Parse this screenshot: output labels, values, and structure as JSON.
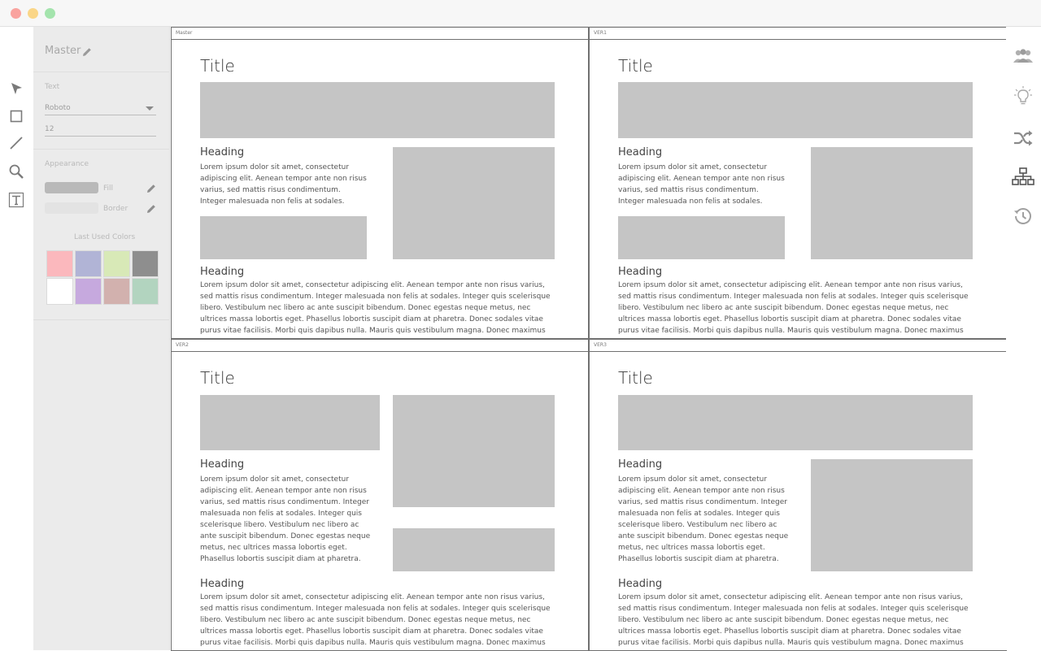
{
  "window": {
    "traffic_lights": [
      "#ff6159",
      "#ffbd2e",
      "#28c941"
    ]
  },
  "left_tools": [
    "pointer-icon",
    "rectangle-icon",
    "line-icon",
    "zoom-icon",
    "text-tool-icon"
  ],
  "properties": {
    "master_name": "Master",
    "text_section_label": "Text",
    "font_family_value": "Roboto",
    "font_size_value": "12",
    "appearance_label": "Appearance",
    "fill_label": "Fill",
    "border_label": "Border",
    "last_used_colors_label": "Last Used Colors",
    "last_used_colors": [
      "#fbb8bd",
      "#b1b4d6",
      "#d8e9b7",
      "#8e8e8e",
      "#ffffff",
      "#c6a9de",
      "#d2b1ae",
      "#b2d4bf"
    ]
  },
  "right_tools": [
    "people-icon",
    "lightbulb-icon",
    "shuffle-icon",
    "sitemap-icon",
    "history-icon"
  ],
  "frames": [
    {
      "label": "Master",
      "title": "Title",
      "heading1": "Heading",
      "para1": "Lorem ipsum dolor sit amet, consectetur adipiscing elit. Aenean tempor ante non risus varius, sed mattis risus condimentum. Integer malesuada non felis at sodales. Integer quis",
      "heading2": "Heading",
      "para2": "Lorem ipsum dolor sit amet, consectetur adipiscing elit. Aenean tempor ante non risus varius, sed mattis risus condimentum. Integer malesuada non felis at sodales. Integer quis scelerisque libero. Vestibulum nec libero ac ante suscipit bibendum. Donec egestas neque metus, nec ultrices massa lobortis eget. Phasellus lobortis suscipit diam at pharetra. Donec sodales vitae purus vitae facilisis. Morbi quis dapibus nulla. Mauris quis vestibulum magna. Donec maximus neque vel libero tincidunt elementum."
    },
    {
      "label": "VER1",
      "title": "Title",
      "heading1": "Heading",
      "para1": "Lorem ipsum dolor sit amet, consectetur adipiscing elit. Aenean tempor ante non risus varius, sed mattis risus condimentum. Integer malesuada non felis at sodales. Integer quis",
      "heading2": "Heading",
      "para2": "Lorem ipsum dolor sit amet, consectetur adipiscing elit. Aenean tempor ante non risus varius, sed mattis risus condimentum. Integer malesuada non felis at sodales. Integer quis scelerisque libero. Vestibulum nec libero ac ante suscipit bibendum. Donec egestas neque metus, nec ultrices massa lobortis eget. Phasellus lobortis suscipit diam at pharetra. Donec sodales vitae purus vitae facilisis. Morbi quis dapibus nulla. Mauris quis vestibulum magna. Donec maximus neque vel libero tincidunt elementum."
    },
    {
      "label": "VER2",
      "title": "Title",
      "heading1": "Heading",
      "para1": "Lorem ipsum dolor sit amet, consectetur adipiscing elit. Aenean tempor ante non risus varius, sed mattis risus condimentum. Integer malesuada non felis at sodales. Integer quis scelerisque libero. Vestibulum nec libero ac ante suscipit bibendum. Donec egestas neque metus, nec ultrices massa lobortis eget. Phasellus lobortis suscipit diam at pharetra. Donec sodales",
      "heading2": "Heading",
      "para2": "Lorem ipsum dolor sit amet, consectetur adipiscing elit. Aenean tempor ante non risus varius, sed mattis risus condimentum. Integer malesuada non felis at sodales. Integer quis scelerisque libero. Vestibulum nec libero ac ante suscipit bibendum. Donec egestas neque metus, nec ultrices massa lobortis eget. Phasellus lobortis suscipit diam at pharetra. Donec sodales vitae purus vitae facilisis. Morbi quis dapibus nulla. Mauris quis vestibulum magna. Donec maximus neque vel libero tincidunt elementum."
    },
    {
      "label": "VER3",
      "title": "Title",
      "heading1": "Heading",
      "para1": "Lorem ipsum dolor sit amet, consectetur adipiscing elit. Aenean tempor ante non risus varius, sed mattis risus condimentum. Integer malesuada non felis at sodales. Integer quis scelerisque libero. Vestibulum nec libero ac ante suscipit bibendum. Donec egestas neque metus, nec ultrices massa lobortis eget. Phasellus lobortis suscipit diam at pharetra. Donec sodales",
      "heading2": "Heading",
      "para2": "Lorem ipsum dolor sit amet, consectetur adipiscing elit. Aenean tempor ante non risus varius, sed mattis risus condimentum. Integer malesuada non felis at sodales. Integer quis scelerisque libero. Vestibulum nec libero ac ante suscipit bibendum. Donec egestas neque metus, nec ultrices massa lobortis eget. Phasellus lobortis suscipit diam at pharetra. Donec sodales vitae purus vitae facilisis. Morbi quis dapibus nulla. Mauris quis vestibulum magna. Donec maximus neque vel libero tincidunt elementum."
    }
  ]
}
